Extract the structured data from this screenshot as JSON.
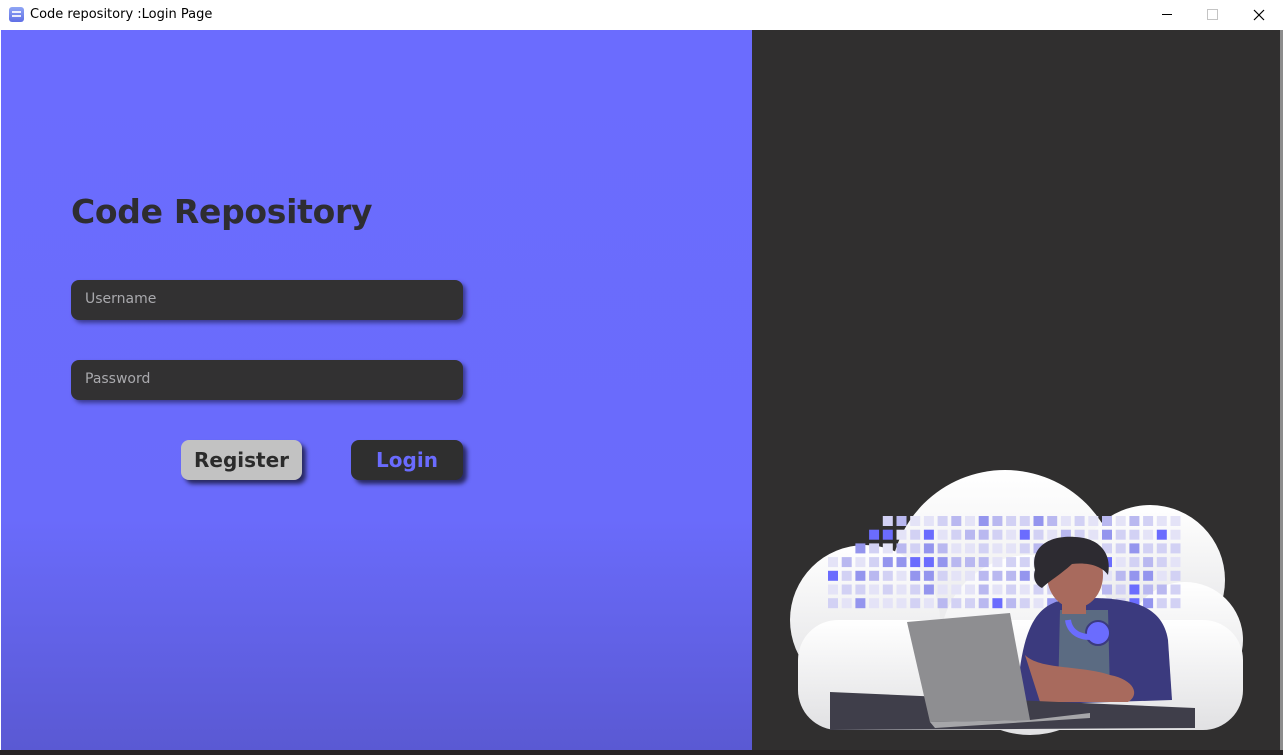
{
  "window": {
    "title": "Code repository :Login Page"
  },
  "login": {
    "heading": "Code Repository",
    "username_placeholder": "Username",
    "password_placeholder": "Password",
    "register_label": "Register",
    "login_label": "Login"
  },
  "colors": {
    "accent": "#6b6cfe",
    "dark_panel": "#302f2f",
    "field_bg": "#323132",
    "register_bg": "#c2c2c2",
    "heading_text": "#2e2d31"
  },
  "icons": {
    "app": "app-icon",
    "minimize": "minimize-icon",
    "maximize": "maximize-icon",
    "close": "close-icon"
  }
}
